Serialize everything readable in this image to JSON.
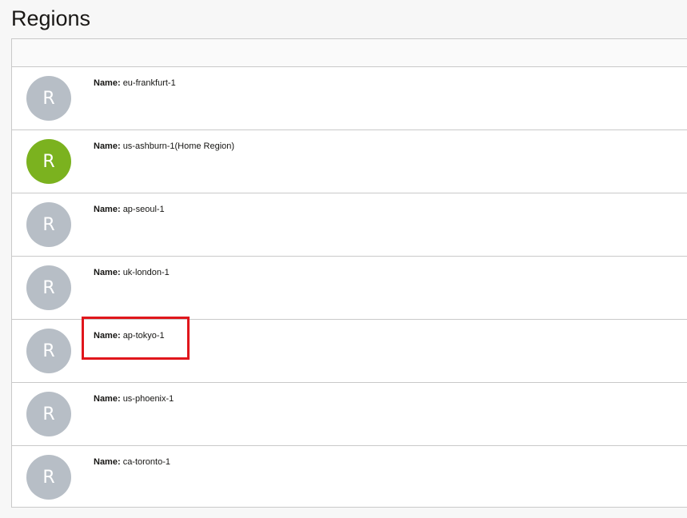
{
  "page": {
    "title": "Regions"
  },
  "regions": [
    {
      "avatar_letter": "R",
      "label": "Name:",
      "name": "eu-frankfurt-1",
      "home": false
    },
    {
      "avatar_letter": "R",
      "label": "Name:",
      "name": "us-ashburn-1(Home Region)",
      "home": true
    },
    {
      "avatar_letter": "R",
      "label": "Name:",
      "name": "ap-seoul-1",
      "home": false
    },
    {
      "avatar_letter": "R",
      "label": "Name:",
      "name": "uk-london-1",
      "home": false
    },
    {
      "avatar_letter": "R",
      "label": "Name:",
      "name": "ap-tokyo-1",
      "home": false
    },
    {
      "avatar_letter": "R",
      "label": "Name:",
      "name": "us-phoenix-1",
      "home": false
    },
    {
      "avatar_letter": "R",
      "label": "Name:",
      "name": "ca-toronto-1",
      "home": false
    }
  ],
  "colors": {
    "home_avatar": "#7bb21f",
    "default_avatar": "#b7bec6",
    "highlight": "#e0161c"
  },
  "annotation": {
    "highlighted_region": "ap-tokyo-1"
  }
}
